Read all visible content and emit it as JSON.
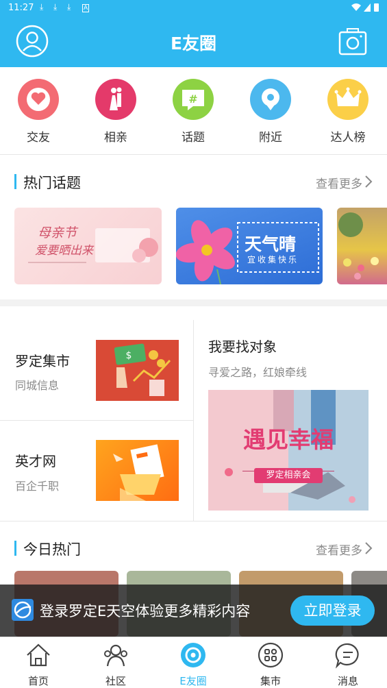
{
  "status_bar": {
    "time": "11:27"
  },
  "header": {
    "title": "E友圈"
  },
  "categories": [
    {
      "label": "交友",
      "icon": "heart-icon",
      "color": "#f36b73"
    },
    {
      "label": "相亲",
      "icon": "couple-icon",
      "color": "#e43a6a"
    },
    {
      "label": "话题",
      "icon": "hashtag-icon",
      "color": "#8dd243"
    },
    {
      "label": "附近",
      "icon": "location-icon",
      "color": "#4cb8ee"
    },
    {
      "label": "达人榜",
      "icon": "crown-icon",
      "color": "#fbcf48"
    }
  ],
  "hot_topics": {
    "title": "热门话题",
    "more": "查看更多",
    "banners": [
      {
        "text_main": "母亲节",
        "text_sub": "爱要晒出来"
      },
      {
        "text_main": "天气晴",
        "text_sub": "宜收集快乐"
      }
    ]
  },
  "market": {
    "items": [
      {
        "title": "罗定集市",
        "subtitle": "同城信息"
      },
      {
        "title": "英才网",
        "subtitle": "百企千职"
      }
    ],
    "featured": {
      "title": "我要找对象",
      "subtitle": "寻爱之路，红娘牵线",
      "image_text_main": "遇见幸福",
      "image_text_sub": "罗定相亲会"
    }
  },
  "today_hot": {
    "title": "今日热门",
    "more": "查看更多"
  },
  "login_banner": {
    "text": "登录罗定E天空体验更多精彩内容",
    "button": "立即登录"
  },
  "bottom_nav": [
    {
      "label": "首页",
      "icon": "home-icon",
      "active": false
    },
    {
      "label": "社区",
      "icon": "community-icon",
      "active": false
    },
    {
      "label": "E友圈",
      "icon": "circle-icon",
      "active": true
    },
    {
      "label": "集市",
      "icon": "market-icon",
      "active": false
    },
    {
      "label": "消息",
      "icon": "message-icon",
      "active": false
    }
  ],
  "colors": {
    "primary": "#2fb8f0",
    "muted_text": "#8a8a8a"
  }
}
